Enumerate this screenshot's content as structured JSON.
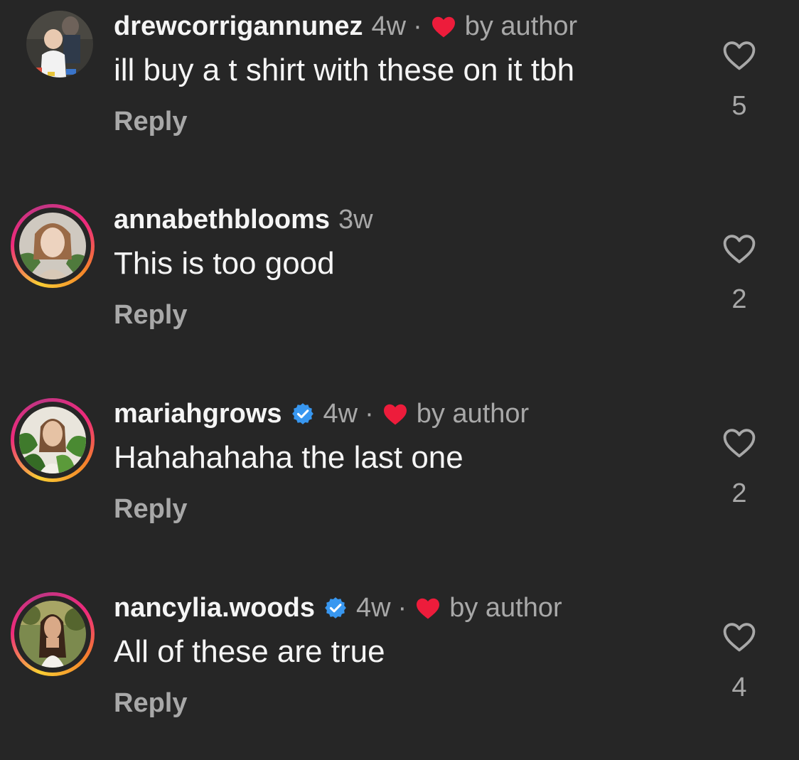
{
  "colors": {
    "background": "#262626",
    "text_primary": "#f5f5f5",
    "text_secondary": "#a8a8a8",
    "liked_heart": "#ed1c3b",
    "verified_badge": "#3897f0"
  },
  "comments": [
    {
      "username": "drewcorrigannunez",
      "verified": false,
      "story_ring": false,
      "time": "4w",
      "separator": "·",
      "liked_by_author_icon": "red-heart-icon",
      "liked_by_author_label": "by author",
      "text": "ill buy a t shirt with these on it tbh",
      "reply_label": "Reply",
      "like_icon": "heart-outline-icon",
      "like_count": "5"
    },
    {
      "username": "annabethblooms",
      "verified": false,
      "story_ring": true,
      "time": "3w",
      "text": "This is too good",
      "reply_label": "Reply",
      "like_icon": "heart-outline-icon",
      "like_count": "2"
    },
    {
      "username": "mariahgrows",
      "verified": true,
      "story_ring": true,
      "time": "4w",
      "separator": "·",
      "liked_by_author_icon": "red-heart-icon",
      "liked_by_author_label": "by author",
      "text": "Hahahahaha the last one",
      "reply_label": "Reply",
      "like_icon": "heart-outline-icon",
      "like_count": "2"
    },
    {
      "username": "nancylia.woods",
      "verified": true,
      "story_ring": true,
      "time": "4w",
      "separator": "·",
      "liked_by_author_icon": "red-heart-icon",
      "liked_by_author_label": "by author",
      "text": "All of these are true",
      "reply_label": "Reply",
      "like_icon": "heart-outline-icon",
      "like_count": "4"
    }
  ]
}
